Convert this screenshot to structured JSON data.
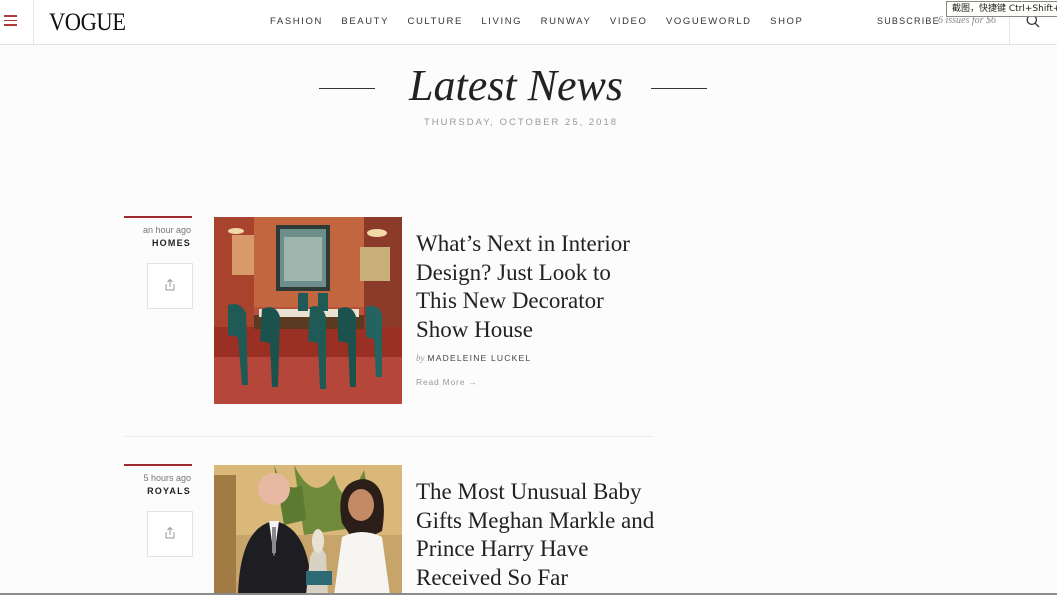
{
  "header": {
    "logo": "VOGUE",
    "nav": [
      "FASHION",
      "BEAUTY",
      "CULTURE",
      "LIVING",
      "RUNWAY",
      "VIDEO",
      "VOGUEWORLD",
      "SHOP"
    ],
    "subscribe_label": "SUBSCRIBE",
    "subscribe_note": "6 issues for $6",
    "accent_color": "#9c2a2e"
  },
  "tooltip": "截图，快捷键 Ctrl+Shift+",
  "page": {
    "title": "Latest News",
    "date": "THURSDAY, OCTOBER 25, 2018"
  },
  "articles": [
    {
      "time_ago": "an hour ago",
      "category": "HOMES",
      "headline": "What’s Next in Interior Design? Just Look to This New Decorator Show House",
      "by": "by",
      "author": "MADELEINE LUCKEL",
      "read_more": "Read More →",
      "image": "interior-dining-room-photo"
    },
    {
      "time_ago": "5 hours ago",
      "category": "ROYALS",
      "headline": "The Most Unusual Baby Gifts Meghan Markle and Prince Harry Have Received So Far",
      "image": "royals-photo"
    }
  ]
}
